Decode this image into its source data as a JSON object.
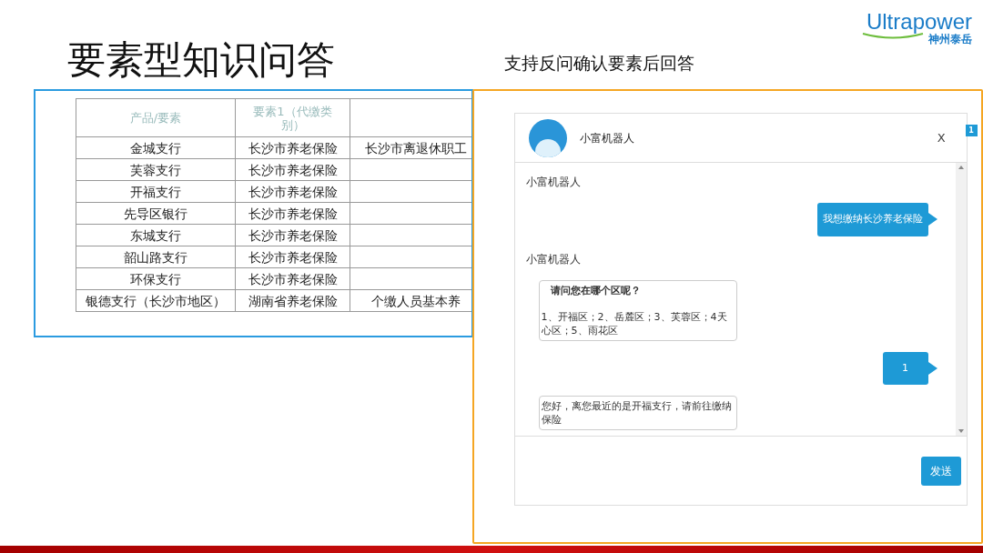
{
  "title": "要素型知识问答",
  "subtitle": "支持反问确认要素后回答",
  "logo": {
    "name": "Ultrapower",
    "tagline": "神州泰岳"
  },
  "table": {
    "columns": [
      "产品/要素",
      "要素1（代缴类别）"
    ],
    "rows": [
      {
        "cells": [
          "金城支行",
          "长沙市养老保险",
          "长沙市离退休职工"
        ]
      },
      {
        "cells": [
          "芙蓉支行",
          "长沙市养老保险"
        ]
      },
      {
        "cells": [
          "开福支行",
          "长沙市养老保险"
        ]
      },
      {
        "cells": [
          "先导区银行",
          "长沙市养老保险"
        ]
      },
      {
        "cells": [
          "东城支行",
          "长沙市养老保险"
        ]
      },
      {
        "cells": [
          "韶山路支行",
          "长沙市养老保险"
        ]
      },
      {
        "cells": [
          "环保支行",
          "长沙市养老保险"
        ]
      },
      {
        "cells": [
          "银德支行（长沙市地区）",
          "湖南省养老保险",
          "个缴人员基本养"
        ]
      }
    ]
  },
  "chat": {
    "bot_name": "小富机器人",
    "close": "X",
    "badge": "1",
    "messages": [
      {
        "kind": "label",
        "text": "小富机器人"
      },
      {
        "kind": "user",
        "text": "我想缴纳长沙养老保险"
      },
      {
        "kind": "label",
        "text": "小富机器人"
      },
      {
        "kind": "bot",
        "title": "请问您在哪个区呢？",
        "text": "1、开福区；2、岳麓区；3、芙蓉区；4天心区；5、雨花区"
      },
      {
        "kind": "user",
        "text": "1"
      },
      {
        "kind": "bot",
        "text": "您好，离您最近的是开福支行，请前往缴纳保险"
      }
    ],
    "send": "发送"
  }
}
